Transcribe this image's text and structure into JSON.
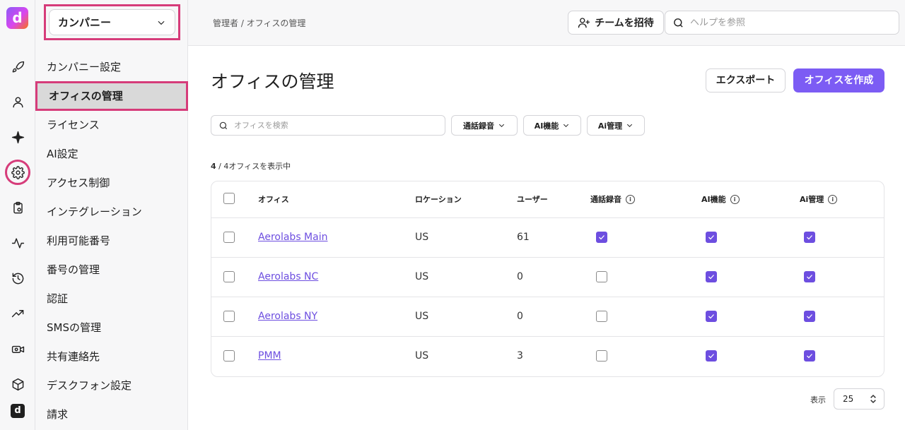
{
  "rail": {
    "logo_letter": "d",
    "mini_logo_letter": "d",
    "icons": [
      "rocket-icon",
      "user-icon",
      "sparkle-icon",
      "gear-icon",
      "clipboard-gear-icon",
      "pulse-icon",
      "history-icon",
      "trending-icon",
      "video-gear-icon",
      "cube-icon",
      "dialpad-logo-icon"
    ]
  },
  "sidebar": {
    "company_label": "カンパニー",
    "items": [
      {
        "label": "カンパニー設定"
      },
      {
        "label": "オフィスの管理"
      },
      {
        "label": "ライセンス"
      },
      {
        "label": "AI設定"
      },
      {
        "label": "アクセス制御"
      },
      {
        "label": "インテグレーション"
      },
      {
        "label": "利用可能番号"
      },
      {
        "label": "番号の管理"
      },
      {
        "label": "認証"
      },
      {
        "label": "SMSの管理"
      },
      {
        "label": "共有連絡先"
      },
      {
        "label": "デスクフォン設定"
      },
      {
        "label": "請求"
      }
    ]
  },
  "header": {
    "breadcrumb": "管理者 / オフィスの管理",
    "invite_label": "チームを招待",
    "help_placeholder": "ヘルプを参照"
  },
  "main": {
    "title": "オフィスの管理",
    "export_label": "エクスポート",
    "create_label": "オフィスを作成",
    "search_placeholder": "オフィスを検索",
    "filters": [
      {
        "label": "通話録音"
      },
      {
        "label": "AI機能"
      },
      {
        "label": "Ai管理"
      }
    ],
    "count_bold": "4",
    "count_rest": " / 4オフィスを表示中",
    "columns": {
      "office": "オフィス",
      "location": "ロケーション",
      "users": "ユーザー",
      "recording": "通話録音",
      "ai_features": "AI機能",
      "ai_management": "Ai管理"
    },
    "rows": [
      {
        "name": "Aerolabs Main",
        "location": "US",
        "users": "61",
        "recording": true,
        "ai_features": true,
        "ai_management": true
      },
      {
        "name": "Aerolabs NC",
        "location": "US",
        "users": "0",
        "recording": false,
        "ai_features": true,
        "ai_management": true
      },
      {
        "name": "Aerolabs NY",
        "location": "US",
        "users": "0",
        "recording": false,
        "ai_features": true,
        "ai_management": true
      },
      {
        "name": "PMM",
        "location": "US",
        "users": "3",
        "recording": false,
        "ai_features": true,
        "ai_management": true
      }
    ],
    "per_page_label": "表示",
    "per_page_value": "25"
  },
  "colors": {
    "accent": "#7c5cf4",
    "highlight": "#d63c7a"
  }
}
